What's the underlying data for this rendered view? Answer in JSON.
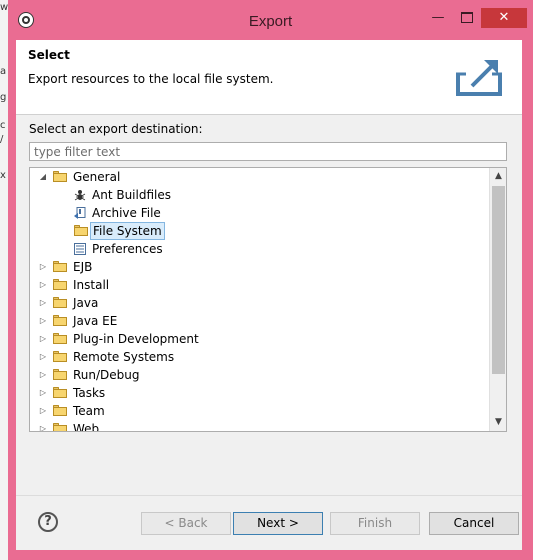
{
  "window": {
    "title": "Export",
    "minimize_glyph": "—",
    "close_glyph": "✕"
  },
  "banner": {
    "title": "Select",
    "message": "Export resources to the local file system."
  },
  "section_label": "Select an export destination:",
  "filter": {
    "placeholder": "type filter text",
    "value": ""
  },
  "tree": {
    "items": [
      {
        "label": "General",
        "expander": "◢",
        "icon": "folder-open-icon"
      },
      {
        "label": "Ant Buildfiles",
        "icon": "ant-icon"
      },
      {
        "label": "Archive File",
        "icon": "archive-icon"
      },
      {
        "label": "File System",
        "icon": "folder-icon",
        "selected": true
      },
      {
        "label": "Preferences",
        "icon": "preferences-icon"
      },
      {
        "label": "EJB",
        "expander": "▷",
        "icon": "folder-icon"
      },
      {
        "label": "Install",
        "expander": "▷",
        "icon": "folder-icon"
      },
      {
        "label": "Java",
        "expander": "▷",
        "icon": "folder-icon"
      },
      {
        "label": "Java EE",
        "expander": "▷",
        "icon": "folder-icon"
      },
      {
        "label": "Plug-in Development",
        "expander": "▷",
        "icon": "folder-icon"
      },
      {
        "label": "Remote Systems",
        "expander": "▷",
        "icon": "folder-icon"
      },
      {
        "label": "Run/Debug",
        "expander": "▷",
        "icon": "folder-icon"
      },
      {
        "label": "Tasks",
        "expander": "▷",
        "icon": "folder-icon"
      },
      {
        "label": "Team",
        "expander": "▷",
        "icon": "folder-icon"
      },
      {
        "label": "Web",
        "expander": "▷",
        "icon": "folder-icon"
      }
    ]
  },
  "buttons": {
    "help": "?",
    "back": "< Back",
    "next": "Next >",
    "finish": "Finish",
    "cancel": "Cancel"
  },
  "background_strip": [
    "w",
    "a",
    "g",
    "c",
    "/",
    "x"
  ],
  "colors": {
    "title_bar": "#ea6c92",
    "close_button": "#c7373b",
    "selection": "#d9ecfb"
  }
}
